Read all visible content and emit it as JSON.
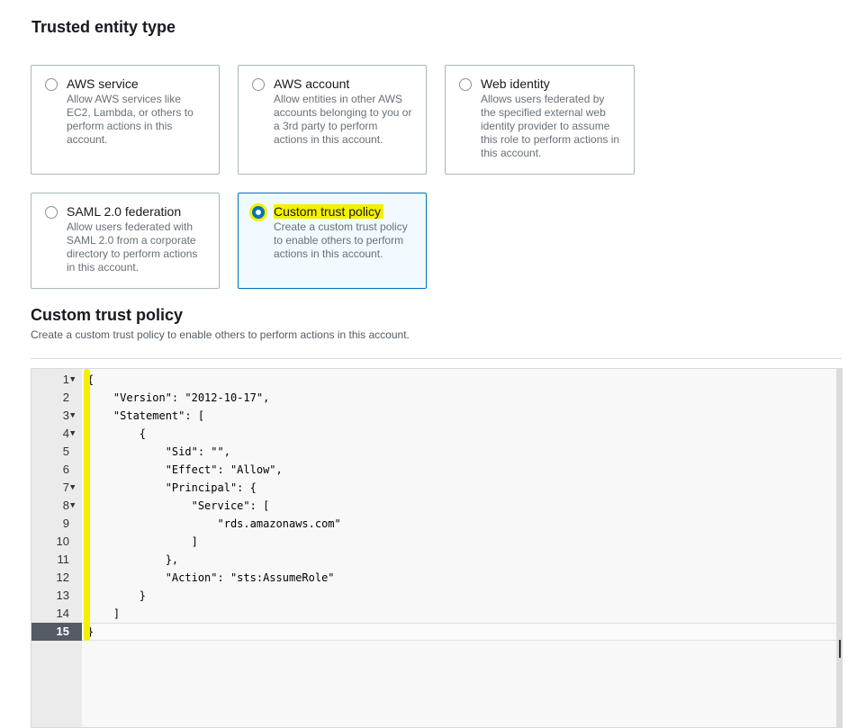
{
  "section": {
    "title": "Trusted entity type"
  },
  "tiles": [
    {
      "title": "AWS service",
      "desc": "Allow AWS services like\nEC2, Lambda, or others to\nperform actions in this\naccount.",
      "selected": false
    },
    {
      "title": "AWS account",
      "desc": "Allow entities in other AWS\naccounts belonging to you or\na 3rd party to perform\nactions in this account.",
      "selected": false
    },
    {
      "title": "Web identity",
      "desc": "Allows users federated by\nthe specified external web\nidentity provider to assume\nthis role to perform actions in\nthis account.",
      "selected": false
    },
    {
      "title": "SAML 2.0 federation",
      "desc": "Allow users federated with\nSAML 2.0 from a corporate\ndirectory to perform actions\nin this account.",
      "selected": false
    },
    {
      "title": "Custom trust policy",
      "desc": "Create a custom trust policy\nto enable others to perform\nactions in this account.",
      "selected": true
    }
  ],
  "policy": {
    "title": "Custom trust policy",
    "description": "Create a custom trust policy to enable others to perform actions in this account."
  },
  "editor": {
    "active_line": "15",
    "lines": [
      {
        "n": "1",
        "fold": "▼",
        "text": "{"
      },
      {
        "n": "2",
        "fold": "",
        "text": "    \"Version\": \"2012-10-17\","
      },
      {
        "n": "3",
        "fold": "▼",
        "text": "    \"Statement\": ["
      },
      {
        "n": "4",
        "fold": "▼",
        "text": "        {"
      },
      {
        "n": "5",
        "fold": "",
        "text": "            \"Sid\": \"\","
      },
      {
        "n": "6",
        "fold": "",
        "text": "            \"Effect\": \"Allow\","
      },
      {
        "n": "7",
        "fold": "▼",
        "text": "            \"Principal\": {"
      },
      {
        "n": "8",
        "fold": "▼",
        "text": "                \"Service\": ["
      },
      {
        "n": "9",
        "fold": "",
        "text": "                    \"rds.amazonaws.com\""
      },
      {
        "n": "10",
        "fold": "",
        "text": "                ]"
      },
      {
        "n": "11",
        "fold": "",
        "text": "            },"
      },
      {
        "n": "12",
        "fold": "",
        "text": "            \"Action\": \"sts:AssumeRole\""
      },
      {
        "n": "13",
        "fold": "",
        "text": "        }"
      },
      {
        "n": "14",
        "fold": "",
        "text": "    ]"
      },
      {
        "n": "15",
        "fold": "",
        "text": "}"
      }
    ]
  },
  "colors": {
    "accent": "#0073bb",
    "highlight": "#f4f000"
  }
}
